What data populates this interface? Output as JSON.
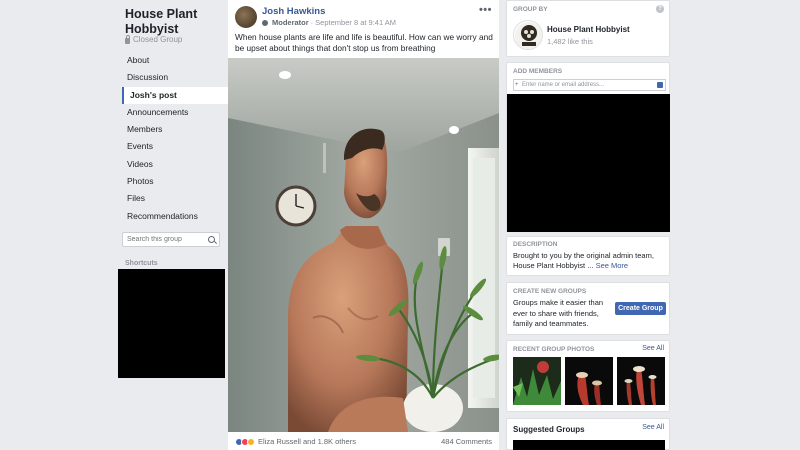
{
  "group": {
    "title": "House Plant Hobbyist",
    "privacy": "Closed Group"
  },
  "nav": {
    "items": [
      "About",
      "Discussion",
      "Josh's post",
      "Announcements",
      "Members",
      "Events",
      "Videos",
      "Photos",
      "Files",
      "Recommendations"
    ],
    "active": "Josh's post"
  },
  "search": {
    "placeholder": "Search this group"
  },
  "shortcuts": {
    "heading": "Shortcuts"
  },
  "post": {
    "author": "Josh Hawkins",
    "role": "Moderator",
    "date": "September 8 at 9:41 AM",
    "text": "When house plants are life and life is beautiful. How can we worry and be upset about things that don't stop us from breathing",
    "reactions_text": "Eliza Russell and 1.8K others",
    "comments": "484 Comments"
  },
  "right": {
    "group_by": {
      "heading": "GROUP BY",
      "name": "House Plant Hobbyist",
      "likes": "1,482 like this"
    },
    "add_members": {
      "heading": "ADD MEMBERS",
      "placeholder": "Enter name or email address..."
    },
    "description": {
      "heading": "DESCRIPTION",
      "text": "Brought to you by the original admin team, House Plant Hobbyist ...",
      "see_more": "See More"
    },
    "create_groups": {
      "heading": "CREATE NEW GROUPS",
      "text": "Groups make it easier than ever to share with friends, family and teammates.",
      "button": "Create Group"
    },
    "recent_photos": {
      "heading": "RECENT GROUP PHOTOS",
      "see_all": "See All"
    },
    "suggested": {
      "title": "Suggested Groups",
      "see_all": "See All"
    }
  },
  "colors": {
    "link": "#385898",
    "accent": "#4267b2",
    "background": "#e9ebee"
  }
}
